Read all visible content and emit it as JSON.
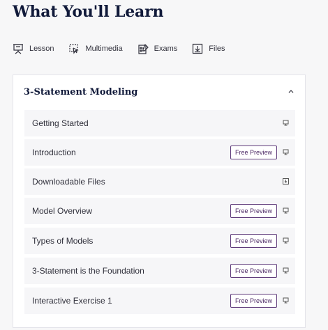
{
  "page": {
    "title": "What You'll Learn"
  },
  "legend": [
    {
      "label": "Lesson",
      "icon": "lesson-icon"
    },
    {
      "label": "Multimedia",
      "icon": "multimedia-icon"
    },
    {
      "label": "Exams",
      "icon": "exams-icon"
    },
    {
      "label": "Files",
      "icon": "files-icon"
    }
  ],
  "section": {
    "title": "3-Statement Modeling",
    "toggle_icon": "chevron-up-icon",
    "lessons": [
      {
        "title": "Getting Started",
        "badge": "",
        "icon": "lesson-icon"
      },
      {
        "title": "Introduction",
        "badge": "Free Preview",
        "icon": "lesson-icon"
      },
      {
        "title": "Downloadable Files",
        "badge": "",
        "icon": "files-icon"
      },
      {
        "title": "Model Overview",
        "badge": "Free Preview",
        "icon": "lesson-icon"
      },
      {
        "title": "Types of Models",
        "badge": "Free Preview",
        "icon": "lesson-icon"
      },
      {
        "title": "3-Statement is the Foundation",
        "badge": "Free Preview",
        "icon": "lesson-icon"
      },
      {
        "title": "Interactive Exercise 1",
        "badge": "Free Preview",
        "icon": "lesson-icon"
      }
    ]
  },
  "colors": {
    "heading": "#111a3a",
    "badge_border": "#5e3a7a",
    "row_bg": "#f6f6f8"
  }
}
